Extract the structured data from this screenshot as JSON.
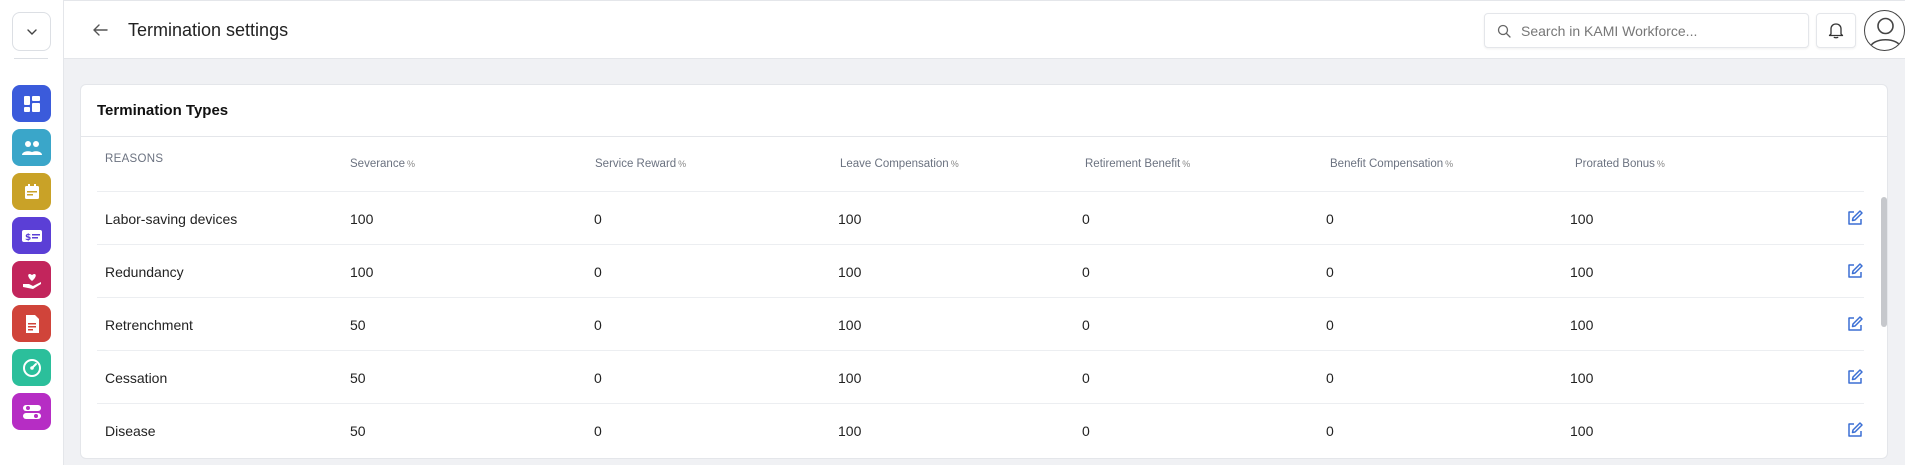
{
  "header": {
    "title": "Termination settings",
    "search_placeholder": "Search in KAMI Workforce..."
  },
  "sidebar": {
    "apps": [
      {
        "icon": "dashboard-icon",
        "color": "#3b5bdb"
      },
      {
        "icon": "people-icon",
        "color": "#3aa6c9"
      },
      {
        "icon": "calendar-icon",
        "color": "#c9a227"
      },
      {
        "icon": "payroll-icon",
        "color": "#5b3fd6"
      },
      {
        "icon": "benefits-heart-icon",
        "color": "#c2255c"
      },
      {
        "icon": "document-icon",
        "color": "#d0443a"
      },
      {
        "icon": "performance-gauge-icon",
        "color": "#2bbf9b"
      },
      {
        "icon": "settings-toggle-icon",
        "color": "#b62dc4"
      }
    ]
  },
  "card": {
    "title": "Termination Types",
    "columns": [
      {
        "label": "REASONS",
        "pct": ""
      },
      {
        "label": "Severance",
        "pct": "%"
      },
      {
        "label": "Service Reward",
        "pct": "%"
      },
      {
        "label": "Leave Compensation",
        "pct": "%"
      },
      {
        "label": "Retirement Benefit",
        "pct": "%"
      },
      {
        "label": "Benefit Compensation",
        "pct": "%"
      },
      {
        "label": "Prorated Bonus",
        "pct": "%"
      }
    ],
    "rows": [
      {
        "reason": "Labor-saving devices",
        "severance": "100",
        "service_reward": "0",
        "leave_compensation": "100",
        "retirement_benefit": "0",
        "benefit_compensation": "0",
        "prorated_bonus": "100"
      },
      {
        "reason": "Redundancy",
        "severance": "100",
        "service_reward": "0",
        "leave_compensation": "100",
        "retirement_benefit": "0",
        "benefit_compensation": "0",
        "prorated_bonus": "100"
      },
      {
        "reason": "Retrenchment",
        "severance": "50",
        "service_reward": "0",
        "leave_compensation": "100",
        "retirement_benefit": "0",
        "benefit_compensation": "0",
        "prorated_bonus": "100"
      },
      {
        "reason": "Cessation",
        "severance": "50",
        "service_reward": "0",
        "leave_compensation": "100",
        "retirement_benefit": "0",
        "benefit_compensation": "0",
        "prorated_bonus": "100"
      },
      {
        "reason": "Disease",
        "severance": "50",
        "service_reward": "0",
        "leave_compensation": "100",
        "retirement_benefit": "0",
        "benefit_compensation": "0",
        "prorated_bonus": "100"
      }
    ]
  },
  "colors": {
    "edit_icon": "#3b6fd4"
  }
}
